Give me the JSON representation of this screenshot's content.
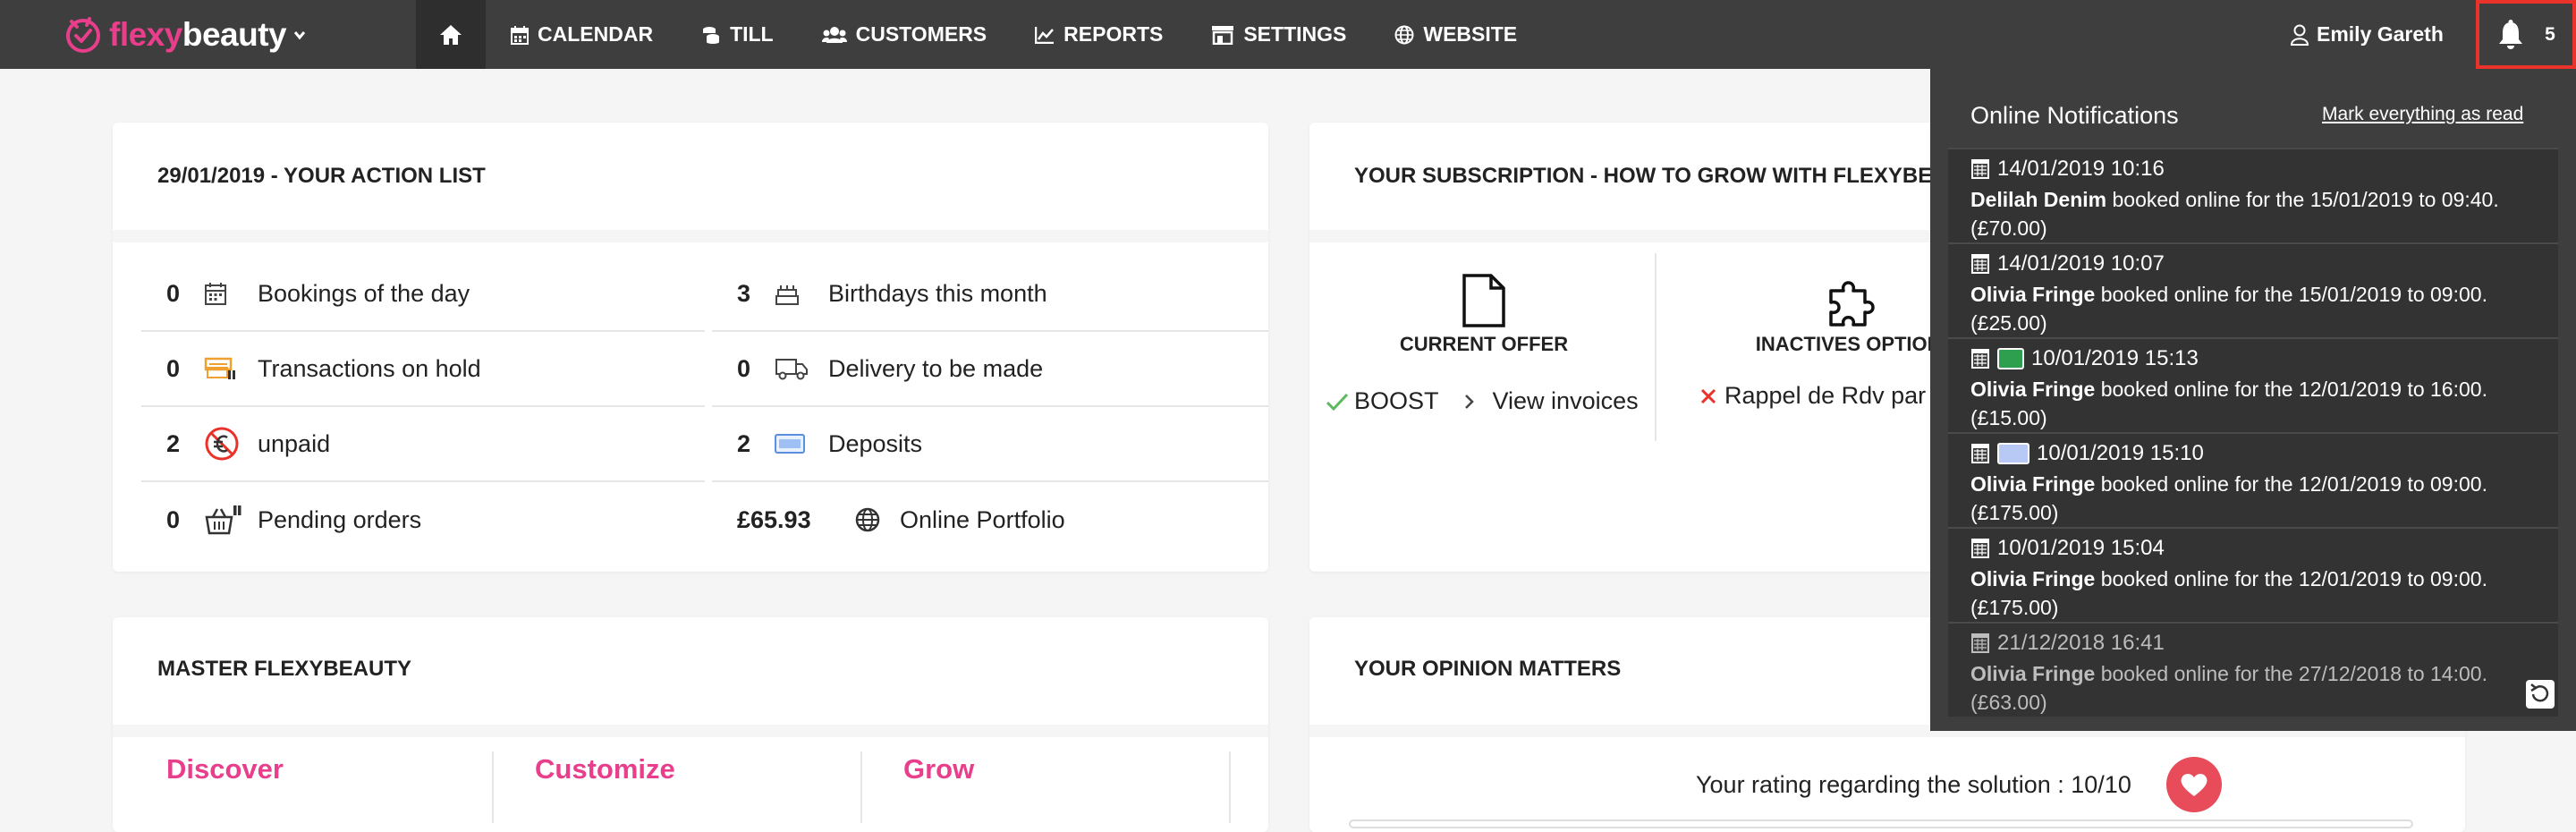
{
  "colors": {
    "brand_pink": "#e83e8c",
    "nav_bg": "#3e3e3e",
    "alert_red": "#e8322a"
  },
  "brand": {
    "part1": "flexy",
    "part2": "beauty"
  },
  "nav": {
    "items": [
      {
        "label": "CALENDAR",
        "icon": "calendar-icon"
      },
      {
        "label": "TILL",
        "icon": "coins-icon"
      },
      {
        "label": "CUSTOMERS",
        "icon": "users-icon"
      },
      {
        "label": "REPORTS",
        "icon": "chart-icon"
      },
      {
        "label": "SETTINGS",
        "icon": "shop-icon"
      },
      {
        "label": "WEBSITE",
        "icon": "globe-icon"
      }
    ],
    "user": "Emily Gareth",
    "notification_count": "5"
  },
  "action_list": {
    "title": "29/01/2019 - YOUR ACTION LIST",
    "left": [
      {
        "value": "0",
        "label": "Bookings of the day"
      },
      {
        "value": "0",
        "label": "Transactions on hold"
      },
      {
        "value": "2",
        "label": "unpaid"
      },
      {
        "value": "0",
        "label": "Pending orders"
      }
    ],
    "right": [
      {
        "value": "3",
        "label": "Birthdays this month"
      },
      {
        "value": "0",
        "label": "Delivery to be made"
      },
      {
        "value": "2",
        "label": "Deposits"
      },
      {
        "value": "£65.93",
        "label": "Online Portfolio"
      }
    ]
  },
  "subscription": {
    "title": "YOUR SUBSCRIPTION - HOW TO GROW WITH FLEXYBEAUTY",
    "current_offer": "CURRENT OFFER",
    "inactive_options": "INACTIVES OPTIONS",
    "boost": "BOOST",
    "view_invoices": "View invoices",
    "rappel": "Rappel de Rdv par sms"
  },
  "master": {
    "title": "MASTER FLEXYBEAUTY",
    "discover": "Discover",
    "customize": "Customize",
    "grow": "Grow"
  },
  "opinion": {
    "title": "YOUR OPINION MATTERS",
    "rating": "Your rating regarding the solution : 10/10"
  },
  "notifications": {
    "title": "Online Notifications",
    "mark_all": "Mark everything as read",
    "items": [
      {
        "time": "14/01/2019 10:16",
        "name": "Delilah Denim",
        "text": "booked online for the 15/01/2019 to 09:40. (£70.00)"
      },
      {
        "time": "14/01/2019 10:07",
        "name": "Olivia Fringe",
        "text": "booked online for the 15/01/2019 to 09:00. (£25.00)"
      },
      {
        "time": "10/01/2019 15:13",
        "name": "Olivia Fringe",
        "text": "booked online for the 12/01/2019 to 16:00. (£15.00)"
      },
      {
        "time": "10/01/2019 15:10",
        "name": "Olivia Fringe",
        "text": "booked online for the 12/01/2019 to 09:00. (£175.00)"
      },
      {
        "time": "10/01/2019 15:04",
        "name": "Olivia Fringe",
        "text": "booked online for the 12/01/2019 to 09:00. (£175.00)"
      },
      {
        "time": "21/12/2018 16:41",
        "name": "Olivia Fringe",
        "text": "booked online for the 27/12/2018 to 14:00. (£63.00)"
      }
    ]
  }
}
